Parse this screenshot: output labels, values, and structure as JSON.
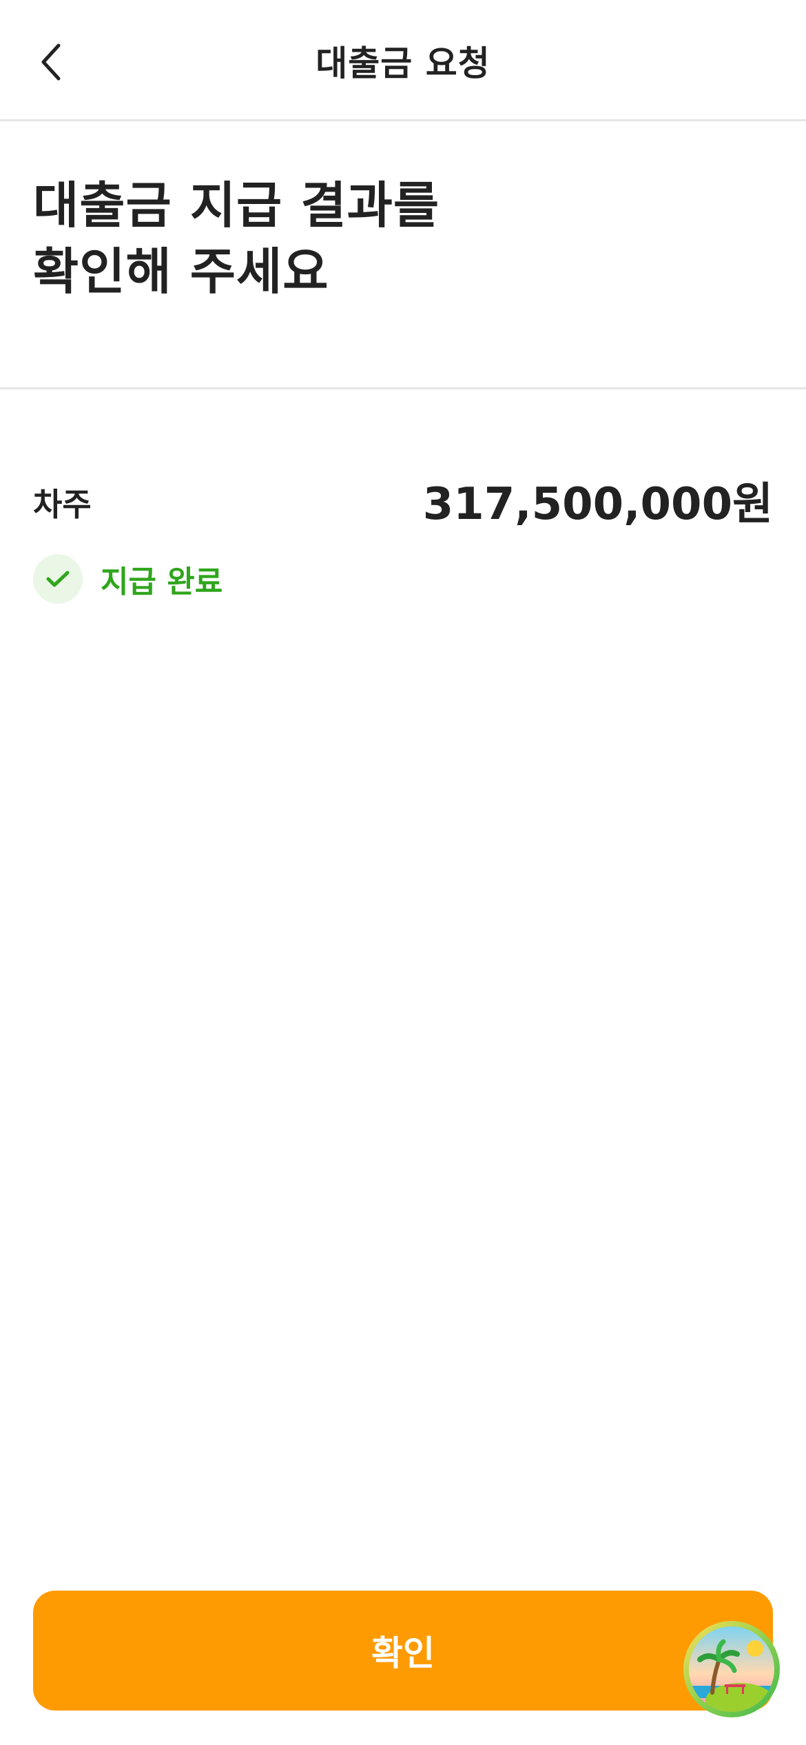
{
  "header": {
    "title": "대출금 요청",
    "back_icon": "chevron-left-icon"
  },
  "headline": {
    "line1": "대출금 지급 결과를",
    "line2": "확인해 주세요"
  },
  "result": {
    "label": "차주",
    "amount": "317,500,000원",
    "status_icon": "check-icon",
    "status_text": "지급 완료"
  },
  "footer": {
    "confirm_label": "확인"
  },
  "floating_button": {
    "icon": "tropical-island-icon"
  },
  "colors": {
    "accent": "#fe9b02",
    "success": "#2fa51c",
    "success_bg": "#eaf7e6",
    "divider": "#e6e6e6",
    "text": "#222222"
  }
}
